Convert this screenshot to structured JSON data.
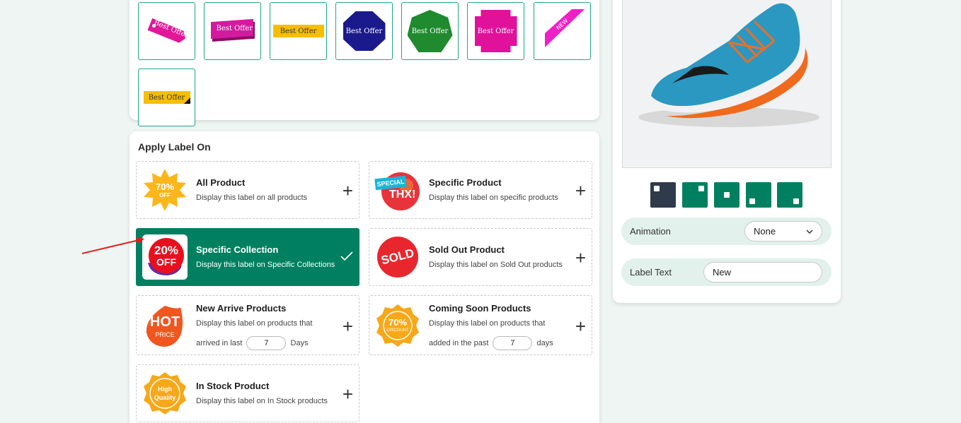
{
  "label_gallery": {
    "items": [
      {
        "name": "tag-pink",
        "text": "Best Offer"
      },
      {
        "name": "ribbon-magenta",
        "text": "Best Offer"
      },
      {
        "name": "banner-yellow",
        "text": "Best Offer"
      },
      {
        "name": "octagon-navy",
        "text": "Best Offer"
      },
      {
        "name": "heptagon-green",
        "text": "Best Offer"
      },
      {
        "name": "stamp-magenta",
        "text": "Best Offer"
      },
      {
        "name": "corner-ribbon-pink",
        "text": "NEW"
      },
      {
        "name": "banner-yellow-corner",
        "text": "Best Offer"
      }
    ]
  },
  "apply_label": {
    "title": "Apply Label On",
    "options": [
      {
        "id": "all",
        "title": "All Product",
        "desc": "Display this label on all products",
        "badge": {
          "line1": "70%",
          "line2": "OFF"
        }
      },
      {
        "id": "specific-product",
        "title": "Specific Product",
        "desc": "Display this label on specific products",
        "badge": {
          "line1": "SPECIAL",
          "line2": "THX!"
        }
      },
      {
        "id": "specific-collection",
        "title": "Specific Collection",
        "desc": "Display this label on Specific Collections",
        "selected": true,
        "badge": {
          "line1": "20%",
          "line2": "OFF"
        }
      },
      {
        "id": "sold-out",
        "title": "Sold Out Product",
        "desc": "Display this label on Sold Out products",
        "badge": {
          "line1": "SOLD"
        }
      },
      {
        "id": "new-arrive",
        "title": "New Arrive Products",
        "desc": "Display this label on products that",
        "desc2_pre": "arrived in last",
        "days": "7",
        "desc2_post": "Days",
        "badge": {
          "line1": "HOT",
          "line2": "PRICE"
        }
      },
      {
        "id": "coming-soon",
        "title": "Coming Soon Products",
        "desc": "Display this label on products that",
        "desc2_pre": "added in the past",
        "days": "7",
        "desc2_post": "days",
        "badge": {
          "line1": "70%",
          "line2": "DISCOUNT"
        }
      },
      {
        "id": "in-stock",
        "title": "In Stock Product",
        "desc": "Display this label on In Stock products",
        "badge": {
          "line1": "High",
          "line2": "Quality"
        }
      }
    ]
  },
  "preview": {
    "positions": [
      "top-left",
      "top-right",
      "center",
      "bottom-left",
      "bottom-right"
    ],
    "active_position": "top-left",
    "animation": {
      "label": "Animation",
      "value": "None"
    },
    "label_text": {
      "label": "Label Text",
      "value": "New"
    }
  },
  "colors": {
    "primary": "#008060",
    "dark": "#2f3a4a",
    "field_bg": "#e2f1ec"
  }
}
